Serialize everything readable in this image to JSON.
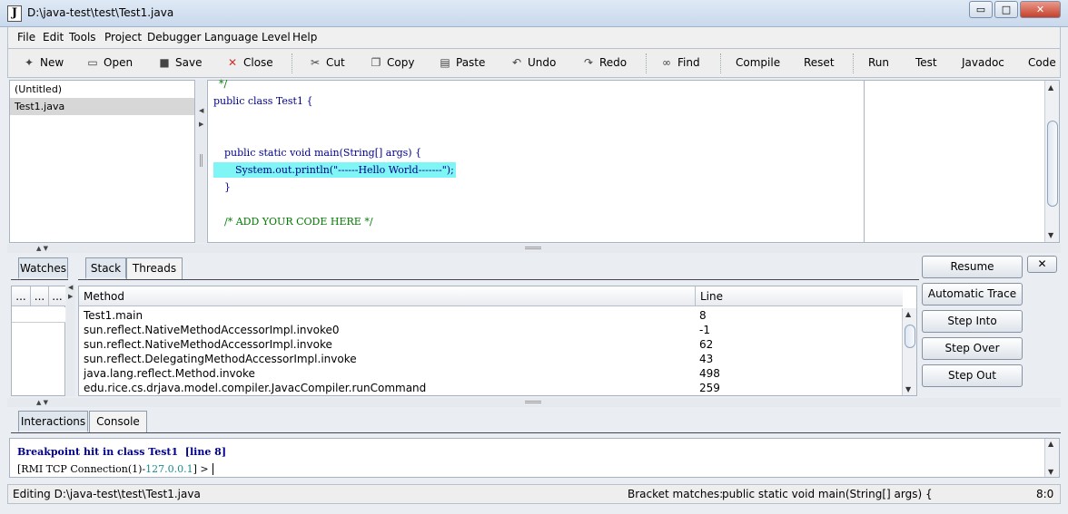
{
  "window": {
    "title": "D:\\java-test\\test\\Test1.java",
    "icon": "J",
    "min_label": "▭",
    "max_label": "□",
    "close_label": "✕"
  },
  "menu": [
    "File",
    "Edit",
    "Tools",
    "Project",
    "Debugger",
    "Language Level",
    "Help"
  ],
  "toolbar": {
    "new": "New",
    "open": "Open",
    "save": "Save",
    "close": "Close",
    "cut": "Cut",
    "copy": "Copy",
    "paste": "Paste",
    "undo": "Undo",
    "redo": "Redo",
    "find": "Find",
    "compile": "Compile",
    "reset": "Reset",
    "run": "Run",
    "test": "Test",
    "javadoc": "Javadoc",
    "code": "Code C"
  },
  "documents": [
    "(Untitled)",
    "Test1.java"
  ],
  "editor": {
    "lines": [
      "*/",
      "public class Test1 {",
      "public static void main(String[] args) {",
      "System.out.println(\"------Hello World-------\");",
      "}",
      "/* ADD YOUR CODE HERE */"
    ]
  },
  "debug": {
    "watches_tab": "Watches",
    "watch_cols": [
      "...",
      "...",
      "..."
    ],
    "stack_tab": "Stack",
    "threads_tab": "Threads",
    "col_method": "Method",
    "col_line": "Line",
    "rows": [
      {
        "method": "Test1.main",
        "line": "8"
      },
      {
        "method": "sun.reflect.NativeMethodAccessorImpl.invoke0",
        "line": "-1"
      },
      {
        "method": "sun.reflect.NativeMethodAccessorImpl.invoke",
        "line": "62"
      },
      {
        "method": "sun.reflect.DelegatingMethodAccessorImpl.invoke",
        "line": "43"
      },
      {
        "method": "java.lang.reflect.Method.invoke",
        "line": "498"
      },
      {
        "method": "edu.rice.cs.drjava.model.compiler.JavacCompiler.runCommand",
        "line": "259"
      }
    ],
    "resume": "Resume",
    "auto_trace": "Automatic Trace",
    "step_into": "Step Into",
    "step_over": "Step Over",
    "step_out": "Step Out",
    "close_x": "✕"
  },
  "bottom": {
    "interactions_tab": "Interactions",
    "console_tab": "Console",
    "breakpoint_msg": "Breakpoint hit in class Test1  [line 8]",
    "prompt_prefix": "[RMI TCP Connection(1)-",
    "prompt_ip": "127.0.0.1",
    "prompt_suffix": "] >"
  },
  "status": {
    "editing": "Editing D:\\java-test\\test\\Test1.java",
    "bracket_label": "Bracket matches:",
    "bracket_value": "public static void main(String[] args) {",
    "position": "8:0"
  }
}
